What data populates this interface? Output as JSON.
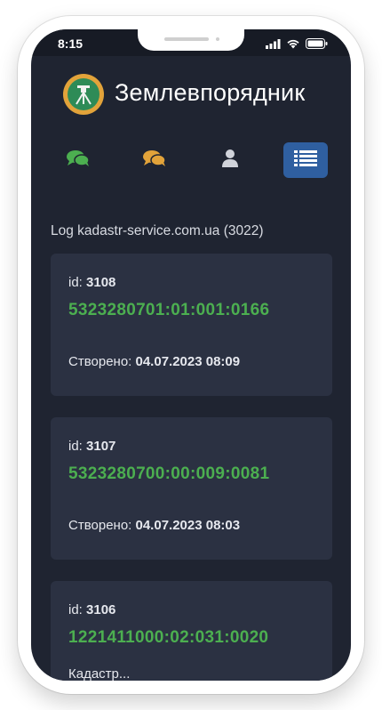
{
  "status_bar": {
    "time": "8:15"
  },
  "header": {
    "title": "Землевпорядник",
    "logo_icon": "theodolite-logo-icon"
  },
  "nav": [
    {
      "icon": "chat-icon",
      "color": "#4caf50",
      "active": false
    },
    {
      "icon": "chat-icon",
      "color": "#e2a33a",
      "active": false
    },
    {
      "icon": "user-icon",
      "color": "#d0d3da",
      "active": false
    },
    {
      "icon": "list-icon",
      "color": "#ffffff",
      "active": true
    }
  ],
  "log": {
    "title": "Log kadastr-service.com.ua (3022)",
    "id_label": "id:",
    "created_label": "Створено:",
    "entries": [
      {
        "id": "3108",
        "cadastral_number": "5323280701:01:001:0166",
        "created": "04.07.2023 08:09"
      },
      {
        "id": "3107",
        "cadastral_number": "5323280700:00:009:0081",
        "created": "04.07.2023 08:03"
      },
      {
        "id": "3106",
        "cadastral_number": "1221411000:02:031:0020",
        "extra": "Кадастр..."
      }
    ]
  },
  "colors": {
    "background": "#1f2431",
    "card": "#2b3142",
    "accent_green": "#4caf50",
    "active_tab": "#2f5fa0"
  }
}
